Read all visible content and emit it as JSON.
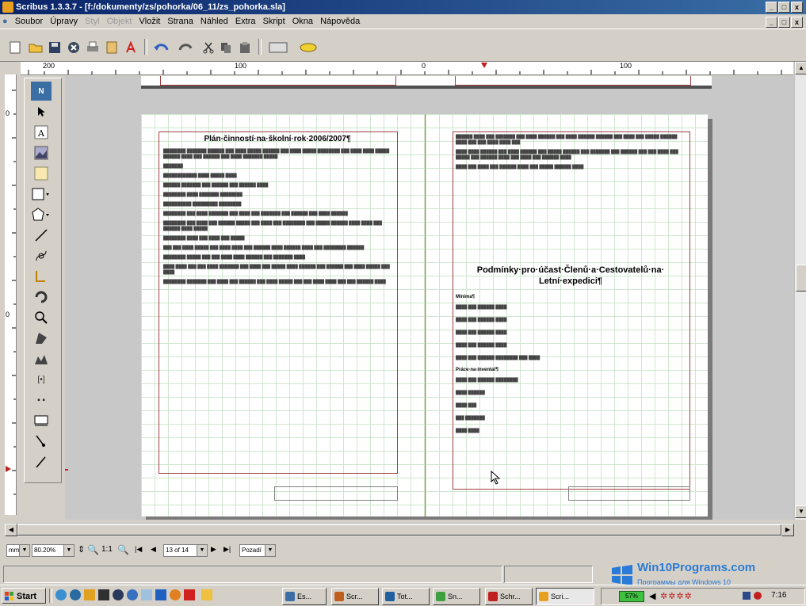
{
  "window": {
    "title": "Scribus 1.3.3.7 - [f:/dokumenty/zs/pohorka/06_11/zs_pohorka.sla]",
    "min_label": "_",
    "max_label": "□",
    "close_label": "x"
  },
  "menu": {
    "items": [
      {
        "label": "Soubor",
        "enabled": true
      },
      {
        "label": "Úpravy",
        "enabled": true
      },
      {
        "label": "Styl",
        "enabled": false
      },
      {
        "label": "Objekt",
        "enabled": false
      },
      {
        "label": "Vložit",
        "enabled": true
      },
      {
        "label": "Strana",
        "enabled": true
      },
      {
        "label": "Náhled",
        "enabled": true
      },
      {
        "label": "Extra",
        "enabled": true
      },
      {
        "label": "Skript",
        "enabled": true
      },
      {
        "label": "Okna",
        "enabled": true
      },
      {
        "label": "Nápověda",
        "enabled": true
      }
    ]
  },
  "ruler": {
    "top_labels": [
      "200",
      "100",
      "0",
      "100"
    ],
    "left_labels": [
      "0",
      "0"
    ]
  },
  "page_left": {
    "heading": "Plán·činností·na·školní·rok·2006/2007¶"
  },
  "page_right": {
    "heading_line1": "Podmínky·pro·účast·Členů·a·Cestovatelů·na·",
    "heading_line2": "Letní·expedici¶",
    "section1": "Minima¶",
    "section2": "Práce·na·inventař¶"
  },
  "nav": {
    "zoom": "80.20%",
    "ratio": "1:1",
    "page": "13 of 14",
    "layer": "Pozadí"
  },
  "taskbar": {
    "start": "Start",
    "tasks": [
      {
        "label": "Es...",
        "color": "#3a6ea5"
      },
      {
        "label": "Scr...",
        "color": "#c06020"
      },
      {
        "label": "Tot...",
        "color": "#2060a0"
      },
      {
        "label": "Sn...",
        "color": "#40a040"
      },
      {
        "label": "Schr...",
        "color": "#c02020"
      },
      {
        "label": "Scri...",
        "color": "#e8a020"
      }
    ],
    "clock": "7:16",
    "battery": "57%"
  },
  "watermark": {
    "brand": "Win10Programs.com",
    "tagline": "Программы для Windows 10"
  }
}
